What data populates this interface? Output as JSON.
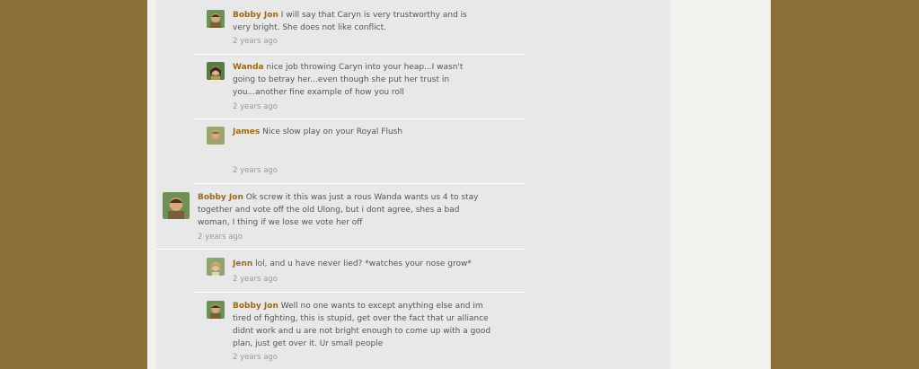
{
  "comments": [
    {
      "author": "Bobby Jon",
      "text": "I will say that Caryn is very trustworthy and is very bright. She does not like conflict.",
      "time": "2 years ago",
      "avatar": "bobby-jon-avatar"
    },
    {
      "author": "Wanda",
      "text": "nice job throwing Caryn into your heap...I wasn't going to betray her...even though she put her trust in you...another fine example of how you roll",
      "time": "2 years ago",
      "avatar": "wanda-avatar"
    },
    {
      "author": "James",
      "text": "Nice slow play on your Royal Flush",
      "time": "2 years ago",
      "avatar": "james-avatar"
    },
    {
      "author": "Bobby Jon",
      "text": "Ok screw it this was just a rous Wanda wants us 4 to stay together and vote off the old Ulong, but i dont agree, shes a bad woman, I thing if we lose we vote her off",
      "time": "2 years ago",
      "avatar": "bobby-jon-avatar"
    },
    {
      "author": "Jenn",
      "text": "lol, and u have never lied? *watches your nose grow*",
      "time": "2 years ago",
      "avatar": "jenn-avatar"
    },
    {
      "author": "Bobby Jon",
      "text": "Well no one wants to except anything else and im tired of fighting, this is stupid, get over the fact that ur alliance didnt work and u are not bright enough to come up with a good plan, just get over it. Ur small people",
      "time": "2 years ago",
      "avatar": "bobby-jon-avatar"
    }
  ],
  "colors": {
    "background": "#8a713a",
    "page": "#f2f1ee",
    "panel": "#e8e8e8",
    "author": "#9a6a1b"
  }
}
